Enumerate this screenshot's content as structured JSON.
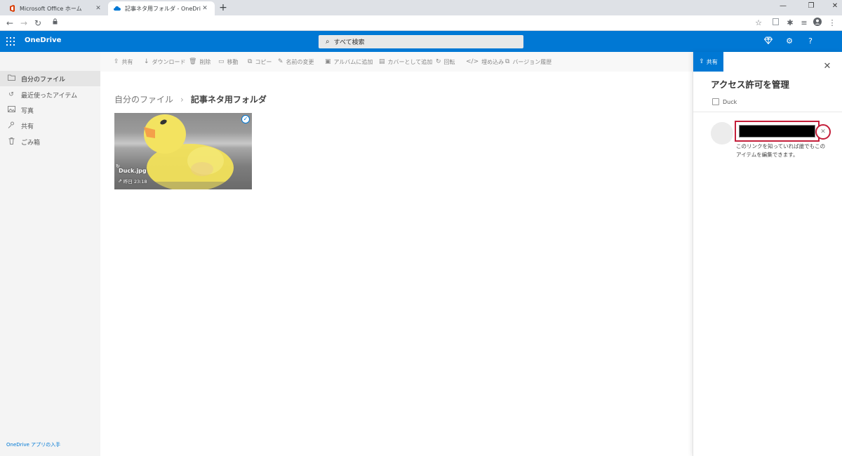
{
  "browser": {
    "tabs": [
      {
        "title": "Microsoft Office ホーム",
        "active": false
      },
      {
        "title": "記事ネタ用フォルダ - OneDrive",
        "active": true
      }
    ],
    "new_tab": "+",
    "window_controls": {
      "minimize": "—",
      "restore": "❐",
      "close": "✕"
    }
  },
  "header": {
    "brand": "OneDrive",
    "search_placeholder": "すべて検索",
    "accent": "#0078d4"
  },
  "leftnav": {
    "items": [
      {
        "label": "自分のファイル",
        "icon": "folder-icon",
        "selected": true
      },
      {
        "label": "最近使ったアイテム",
        "icon": "history-icon",
        "selected": false
      },
      {
        "label": "写真",
        "icon": "photo-icon",
        "selected": false
      },
      {
        "label": "共有",
        "icon": "people-icon",
        "selected": false
      },
      {
        "label": "ごみ箱",
        "icon": "trash-icon",
        "selected": false
      }
    ],
    "get_app": "OneDrive アプリの入手"
  },
  "commands": [
    {
      "label": "共有",
      "icon": "share-icon"
    },
    {
      "label": "ダウンロード",
      "icon": "download-icon"
    },
    {
      "label": "削除",
      "icon": "trash-icon"
    },
    {
      "label": "移動",
      "icon": "move-icon"
    },
    {
      "label": "コピー",
      "icon": "copy-icon"
    },
    {
      "label": "名前の変更",
      "icon": "rename-icon"
    },
    {
      "label": "アルバムに追加",
      "icon": "album-icon"
    },
    {
      "label": "カバーとして追加",
      "icon": "cover-icon"
    },
    {
      "label": "回転",
      "icon": "rotate-icon"
    },
    {
      "label": "埋め込み",
      "icon": "embed-icon"
    },
    {
      "label": "バージョン履歴",
      "icon": "version-history-icon"
    }
  ],
  "breadcrumb": {
    "root": "自分のファイル",
    "separator": "›",
    "current": "記事ネタ用フォルダ"
  },
  "file": {
    "name": "Duck.jpg",
    "modified": "昨日 23:18",
    "selected": true
  },
  "panel": {
    "tab_label": "共有",
    "title": "アクセス許可を管理",
    "item_name": "Duck",
    "link_description": "このリンクを知っていれば誰でもこのアイテムを編集できます。",
    "highlight_color": "#c41e3a"
  }
}
